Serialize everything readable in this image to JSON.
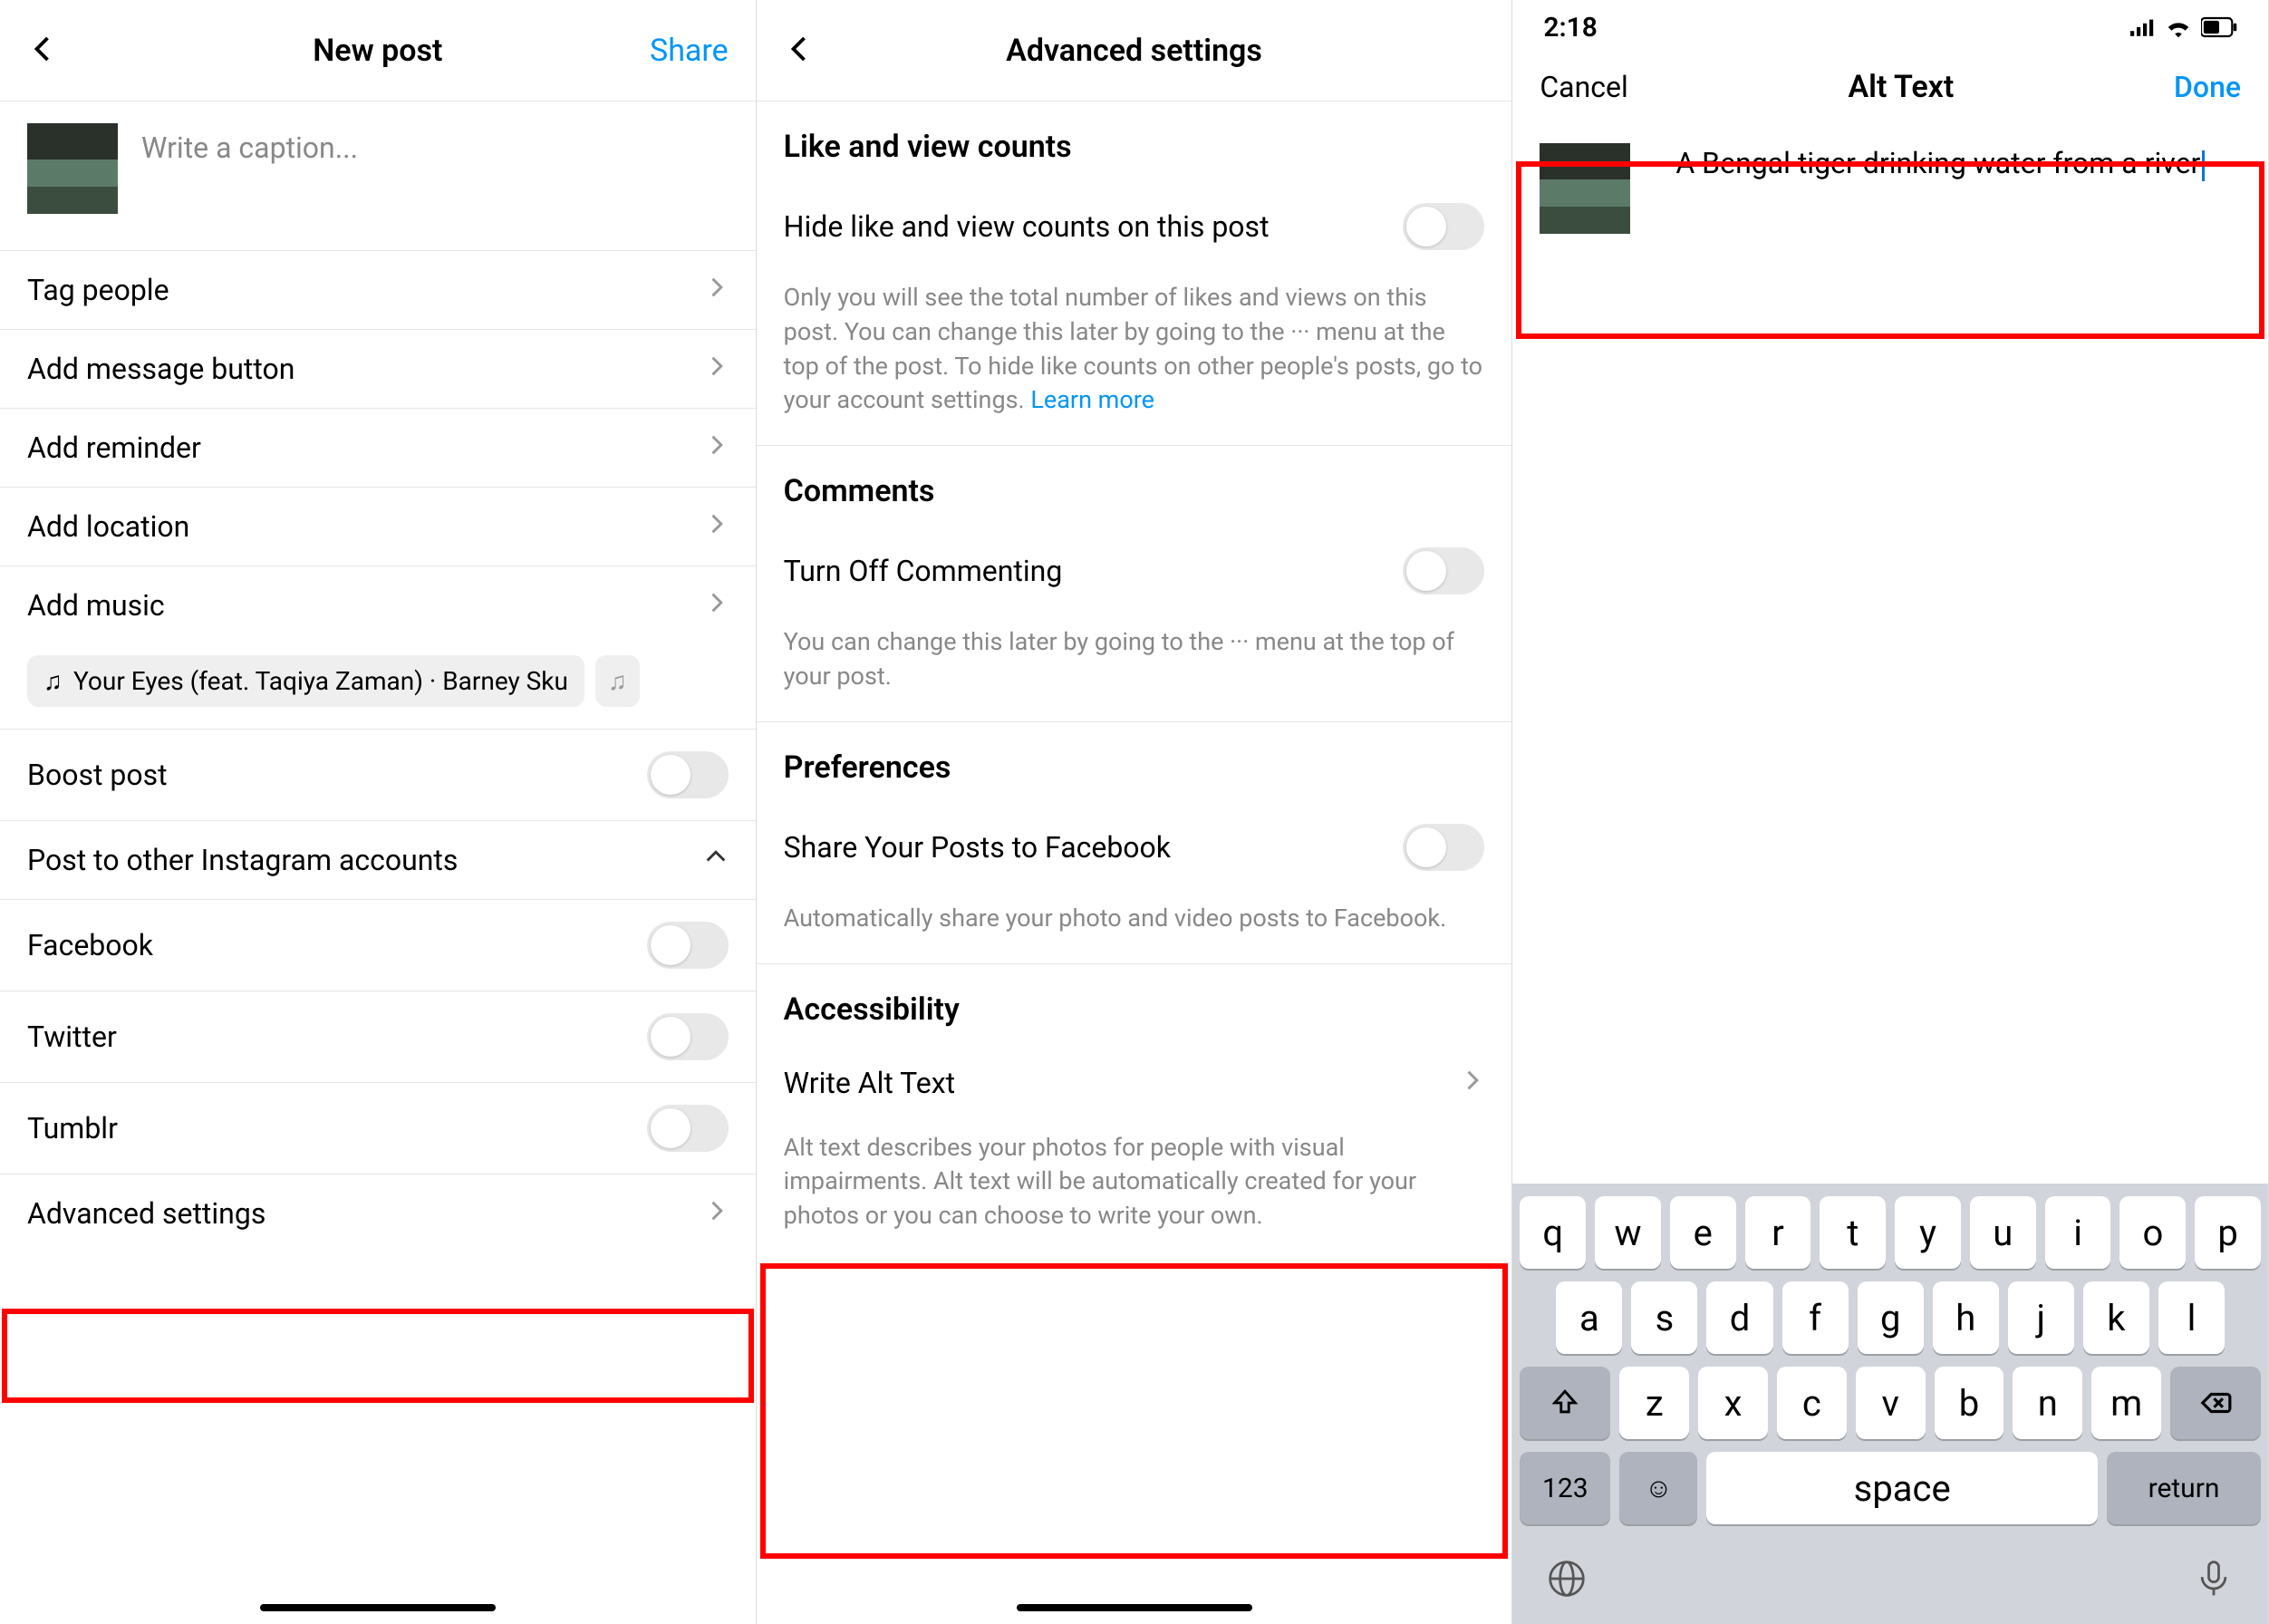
{
  "panel1": {
    "title": "New post",
    "share": "Share",
    "caption_placeholder": "Write a caption...",
    "rows": {
      "tag_people": "Tag people",
      "add_message_button": "Add message button",
      "add_reminder": "Add reminder",
      "add_location": "Add location",
      "add_music": "Add music"
    },
    "music_chip": "Your Eyes (feat. Taqiya Zaman) · Barney Sku",
    "boost_post": "Boost post",
    "post_to_other": "Post to other Instagram accounts",
    "social": {
      "facebook": "Facebook",
      "twitter": "Twitter",
      "tumblr": "Tumblr"
    },
    "advanced_settings": "Advanced settings"
  },
  "panel2": {
    "title": "Advanced settings",
    "like_view_heading": "Like and view counts",
    "hide_like": "Hide like and view counts on this post",
    "like_helper": "Only you will see the total number of likes and views on this post. You can change this later by going to the ··· menu at the top of the post. To hide like counts on other people's posts, go to your account settings.",
    "learn_more": "Learn more",
    "comments_heading": "Comments",
    "turn_off_commenting": "Turn Off Commenting",
    "comments_helper": "You can change this later by going to the ··· menu at the top of your post.",
    "preferences_heading": "Preferences",
    "share_fb": "Share Your Posts to Facebook",
    "pref_helper": "Automatically share your photo and video posts to Facebook.",
    "accessibility_heading": "Accessibility",
    "write_alt_text": "Write Alt Text",
    "acc_helper": "Alt text describes your photos for people with visual impairments. Alt text will be automatically created for your photos or you can choose to write your own."
  },
  "panel3": {
    "time": "2:18",
    "title": "Alt Text",
    "cancel": "Cancel",
    "done": "Done",
    "alt_text_value": "A Bengal tiger drinking water from a river",
    "keyboard": {
      "row1": [
        "q",
        "w",
        "e",
        "r",
        "t",
        "y",
        "u",
        "i",
        "o",
        "p"
      ],
      "row2": [
        "a",
        "s",
        "d",
        "f",
        "g",
        "h",
        "j",
        "k",
        "l"
      ],
      "row3": [
        "z",
        "x",
        "c",
        "v",
        "b",
        "n",
        "m"
      ],
      "numbers": "123",
      "space": "space",
      "return": "return"
    }
  }
}
